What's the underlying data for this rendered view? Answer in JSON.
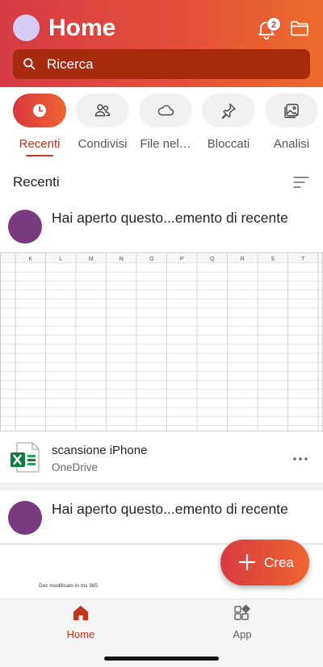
{
  "header": {
    "title": "Home",
    "notification_count": "2",
    "search_placeholder": "Ricerca"
  },
  "tabs": [
    {
      "label": "Recenti",
      "icon": "clock-icon",
      "active": true
    },
    {
      "label": "Condivisi",
      "icon": "people-icon",
      "active": false
    },
    {
      "label": "File nel…",
      "icon": "cloud-icon",
      "active": false
    },
    {
      "label": "Bloccati",
      "icon": "pin-icon",
      "active": false
    },
    {
      "label": "Analisi",
      "icon": "image-icon",
      "active": false
    }
  ],
  "section": {
    "title": "Recenti"
  },
  "activity": [
    {
      "text": "Hai aperto questo...emento di recente"
    },
    {
      "text": "Hai aperto questo...emento di recente"
    }
  ],
  "sheet": {
    "columns": [
      "K",
      "L",
      "M",
      "N",
      "O",
      "P",
      "Q",
      "R",
      "S",
      "T"
    ]
  },
  "file": {
    "name": "scansione iPhone",
    "location": "OneDrive",
    "icon": "excel-icon"
  },
  "doc_preview": {
    "text": "Doc modificato in ms 365"
  },
  "fab": {
    "label": "Crea"
  },
  "nav": [
    {
      "label": "Home",
      "icon": "home-icon",
      "active": true
    },
    {
      "label": "App",
      "icon": "apps-icon",
      "active": false
    }
  ],
  "colors": {
    "accent": "#c4331e",
    "gradient_start": "#d63a44",
    "gradient_end": "#ec6a2a",
    "avatar": "#7a3a80"
  }
}
